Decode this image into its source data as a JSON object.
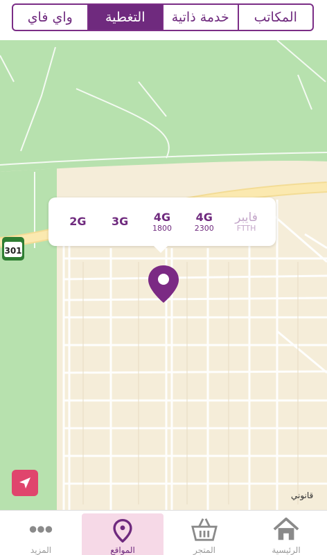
{
  "segments": [
    {
      "label": "المكاتب",
      "active": false
    },
    {
      "label": "خدمة ذاتية",
      "active": false
    },
    {
      "label": "التغطية",
      "active": true
    },
    {
      "label": "واي فاي",
      "active": false
    }
  ],
  "coverage": [
    {
      "main": "فايبر",
      "sub": "FTTH",
      "dim": true
    },
    {
      "main": "4G",
      "sub": "2300",
      "dim": false
    },
    {
      "main": "4G",
      "sub": "1800",
      "dim": false
    },
    {
      "main": "3G",
      "sub": "",
      "dim": false
    },
    {
      "main": "2G",
      "sub": "",
      "dim": false
    }
  ],
  "map": {
    "road_shield": "301",
    "legal_label": "قانوني",
    "land_color": "#f5edd9",
    "park_color": "#b7e1ae",
    "road_color": "#fbe7a8",
    "pin_color": "#7b2a84"
  },
  "tabs": [
    {
      "label": "الرئيسية",
      "icon": "home-icon",
      "active": false
    },
    {
      "label": "المتجر",
      "icon": "basket-icon",
      "active": false
    },
    {
      "label": "المواقع",
      "icon": "location-pin-icon",
      "active": true
    },
    {
      "label": "المزيد",
      "icon": "more-dots-icon",
      "active": false
    }
  ],
  "accent_color": "#6f2a7e",
  "locate_button_color": "#e0456d"
}
